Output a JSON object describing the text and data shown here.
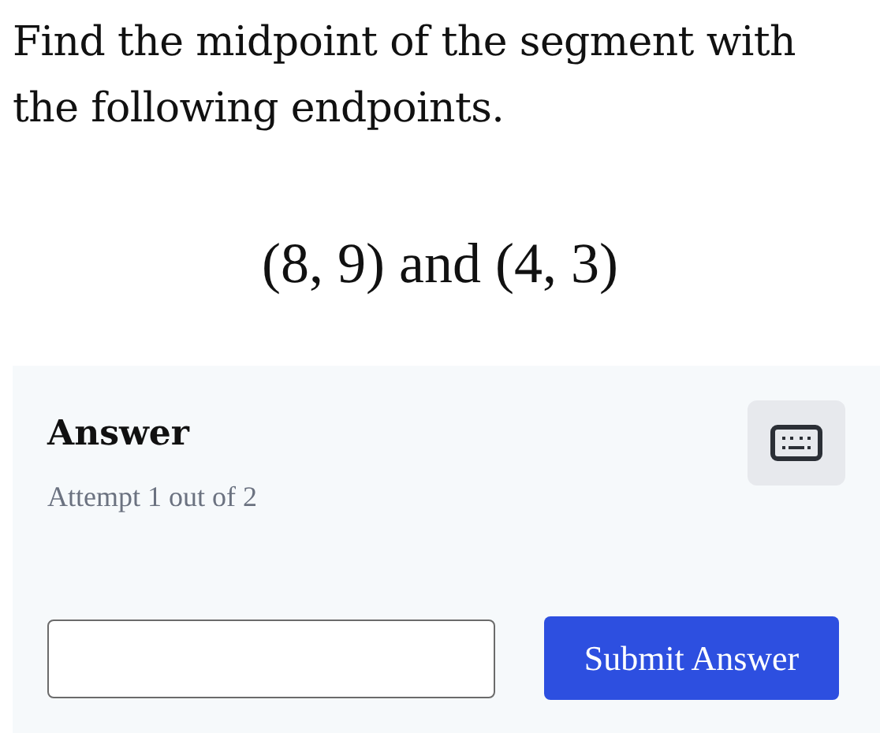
{
  "question": "Find the midpoint of the segment with the following endpoints.",
  "expression": "(8, 9) and (4, 3)",
  "answer_panel": {
    "heading": "Answer",
    "attempt": "Attempt 1 out of 2",
    "submit_button": "Submit Answer"
  }
}
